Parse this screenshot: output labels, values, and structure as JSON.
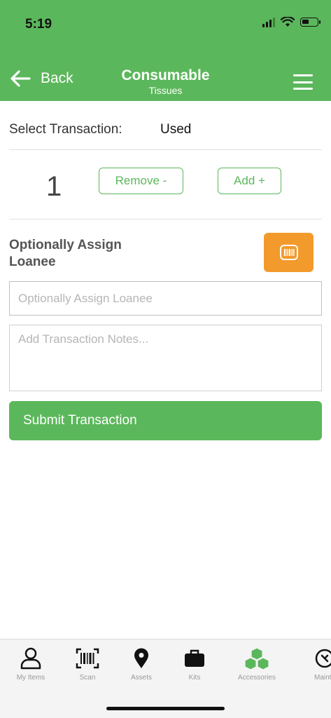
{
  "status": {
    "time": "5:19"
  },
  "header": {
    "back_label": "Back",
    "title": "Consumable",
    "subtitle": "Tissues"
  },
  "transaction": {
    "label": "Select Transaction:",
    "value": "Used"
  },
  "quantity": {
    "value": "1",
    "remove_label": "Remove -",
    "add_label": "Add +"
  },
  "loanee": {
    "label": "Optionally Assign Loanee",
    "placeholder": "Optionally Assign Loanee"
  },
  "notes": {
    "placeholder": "Add Transaction Notes..."
  },
  "submit_label": "Submit Transaction",
  "tabs": [
    {
      "label": "My Items",
      "icon": "person-icon"
    },
    {
      "label": "Scan",
      "icon": "barcode-icon"
    },
    {
      "label": "Assets",
      "icon": "location-pin-icon"
    },
    {
      "label": "Kits",
      "icon": "briefcase-icon"
    },
    {
      "label": "Accessories",
      "icon": "boxes-icon",
      "active": true
    },
    {
      "label": "Mainte",
      "icon": "maintenance-icon"
    }
  ],
  "colors": {
    "brand": "#5bb75b",
    "scan_button": "#f39a2c",
    "tab_active": "#5bb75b"
  }
}
